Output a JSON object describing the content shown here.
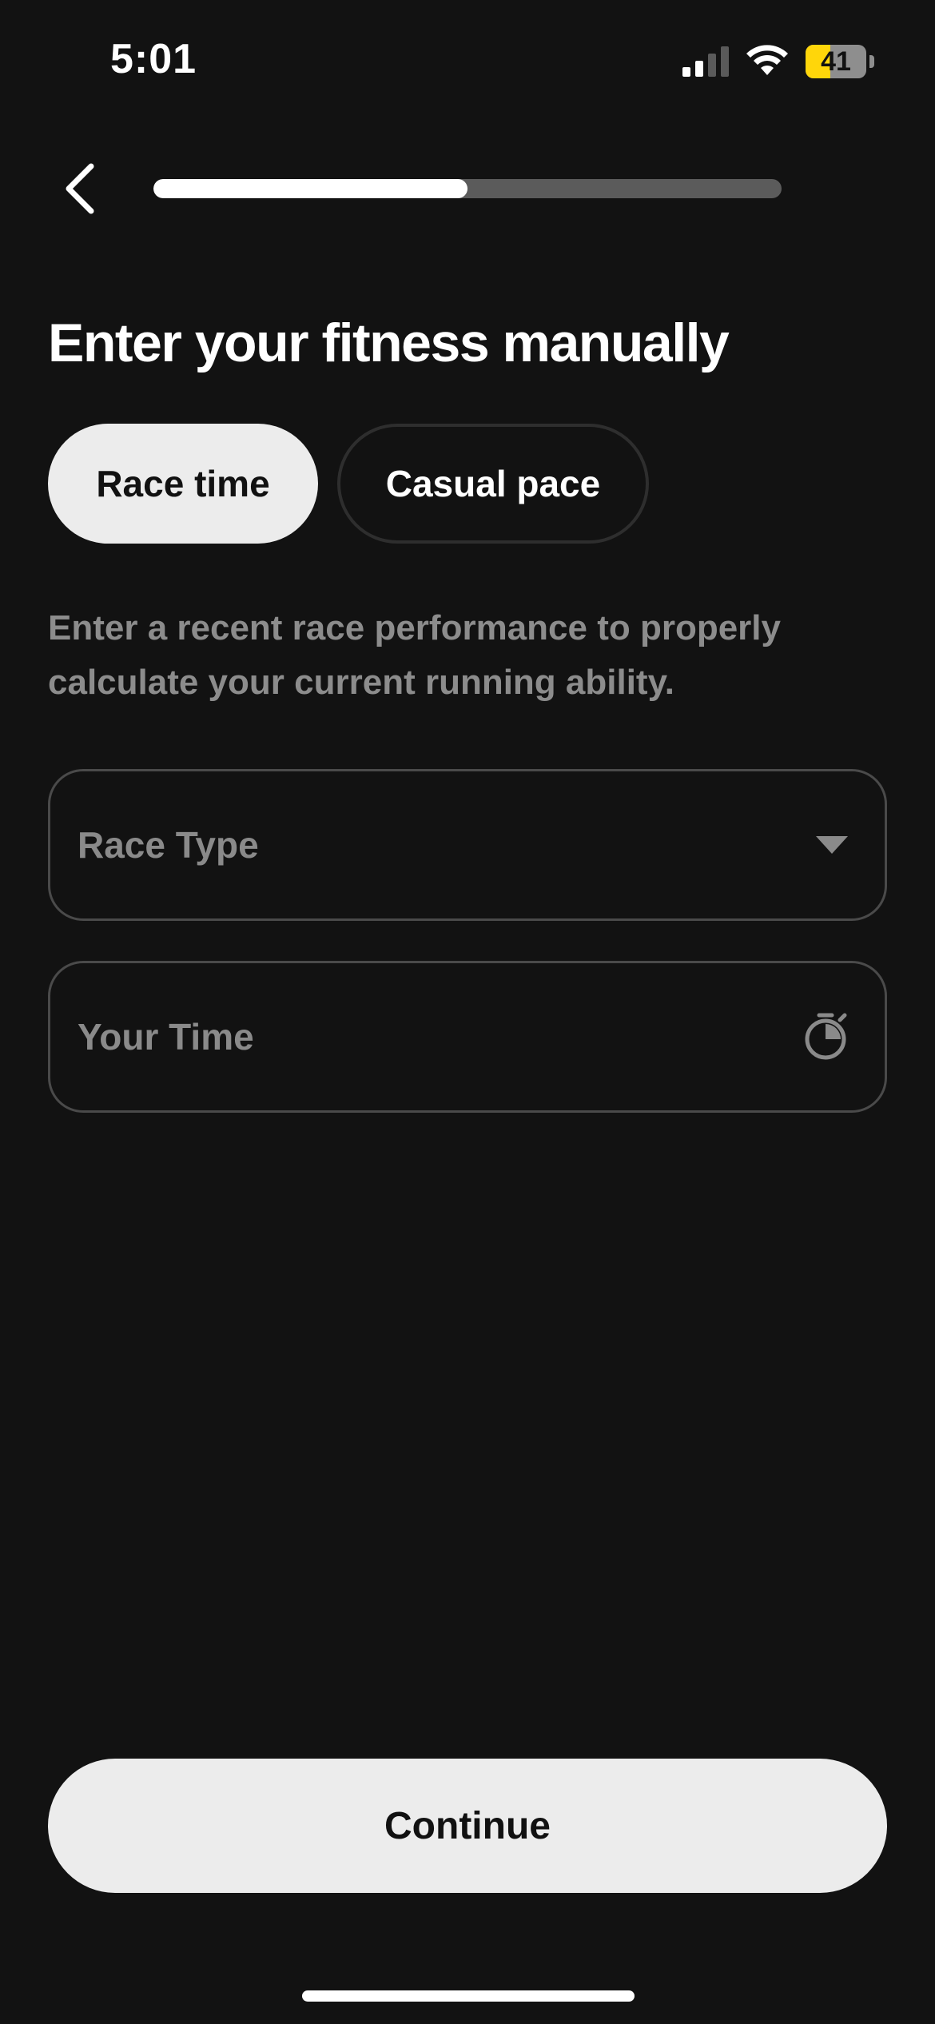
{
  "status_bar": {
    "time": "5:01",
    "battery_level": "41",
    "battery_fraction": 0.41,
    "signal_bars_active": 2,
    "signal_bars_total": 4,
    "icons": [
      "signal-icon",
      "wifi-icon",
      "battery-icon"
    ],
    "battery_color": "#ffd60a"
  },
  "nav": {
    "back_icon": "chevron-left-icon",
    "progress": 0.5
  },
  "page": {
    "title": "Enter your fitness manually",
    "description": "Enter a recent race performance to properly calculate your current running ability."
  },
  "tabs": [
    {
      "label": "Race time",
      "selected": true
    },
    {
      "label": "Casual pace",
      "selected": false
    }
  ],
  "fields": {
    "race_type": {
      "placeholder": "Race Type",
      "icon": "caret-down-icon"
    },
    "your_time": {
      "placeholder": "Your Time",
      "icon": "stopwatch-icon"
    }
  },
  "actions": {
    "continue_label": "Continue"
  },
  "colors": {
    "background": "#121212",
    "primary_button": "#ececec",
    "muted_text": "#8c8c8c"
  }
}
